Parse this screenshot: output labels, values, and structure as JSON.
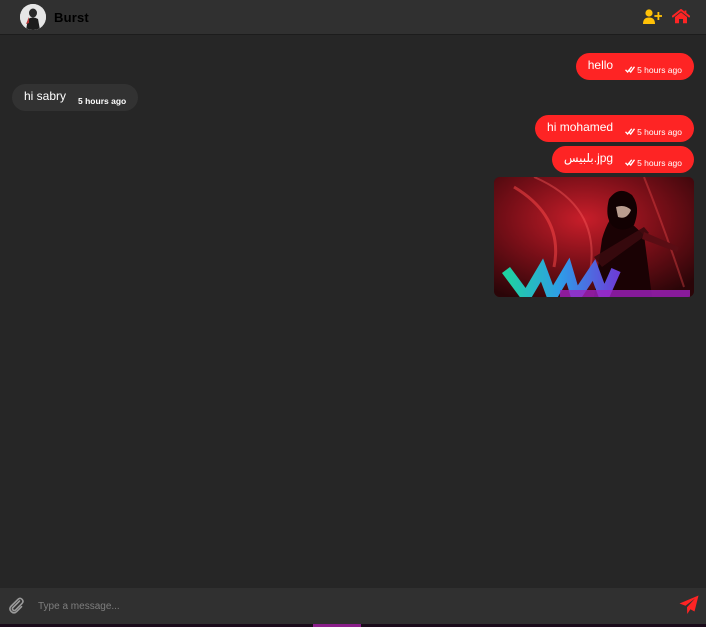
{
  "header": {
    "title": "Burst",
    "avatar_icon": "user-avatar",
    "add_user_icon": "user-plus-icon",
    "home_icon": "home-icon",
    "colors": {
      "add_user": "#ffc107",
      "home": "#fe2424"
    }
  },
  "messages": [
    {
      "direction": "outgoing",
      "text": "hello",
      "time": "5 hours ago",
      "status_icon": "double-check-icon"
    },
    {
      "direction": "incoming",
      "text": "hi sabry",
      "time": "5 hours ago"
    },
    {
      "direction": "outgoing",
      "text": "hi mohamed",
      "time": "5 hours ago",
      "status_icon": "double-check-icon"
    },
    {
      "direction": "outgoing",
      "text": "بلبيس.jpg",
      "time": "5 hours ago",
      "status_icon": "double-check-icon"
    }
  ],
  "composer": {
    "placeholder": "Type a message...",
    "value": "",
    "attach_icon": "paperclip-icon",
    "send_icon": "paper-plane-icon"
  },
  "colors": {
    "outgoing_bubble": "#fe2424",
    "incoming_bubble": "#323232",
    "background": "#262626",
    "bar": "#303030"
  }
}
